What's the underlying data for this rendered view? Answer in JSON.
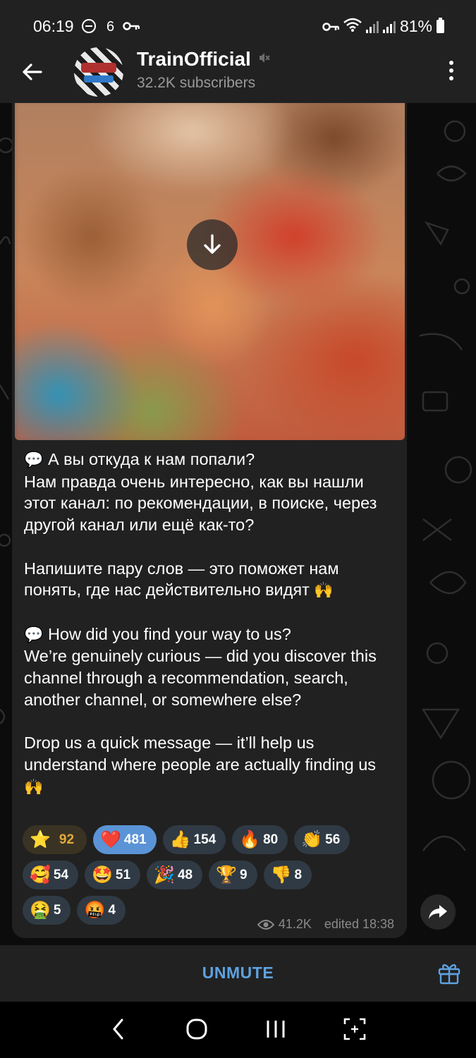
{
  "status_bar": {
    "time": "06:19",
    "notif_count": "6",
    "battery": "81%"
  },
  "header": {
    "channel_name": "TrainOfficial",
    "subscribers": "32.2K subscribers"
  },
  "message": {
    "paragraphs": [
      "А вы откуда к нам попали?\nНам правда очень интересно, как вы нашли этот канал: по рекомендации, в поиске, через другой канал или ещё как-то?",
      "Напишите пару слов — это поможет нам понять, где нас действительно видят",
      "How did you find your way to us?\nWe’re genuinely curious — did you discover this channel through a recommendation, search, another channel, or somewhere else?",
      "Drop us a quick message — it’ll help us understand where people are actually finding us"
    ],
    "p1_line1": "А вы откуда к нам попали?",
    "p1_rest": "Нам правда очень интересно, как вы нашли этот канал: по рекомендации, в поиске, через другой канал или ещё как-то?",
    "p2": "Напишите пару слов — это поможет нам понять, где нас действительно видят",
    "p3_line1": "How did you find your way to us?",
    "p3_rest": "We’re genuinely curious — did you discover this channel through a recommendation, search, another channel, or somewhere else?",
    "p4": "Drop us a quick message — it’ll help us understand where people are actually finding us",
    "views": "41.2K",
    "edited": "edited 18:38"
  },
  "reactions": {
    "row1": [
      {
        "emoji": "⭐",
        "count": "92"
      },
      {
        "emoji": "❤️",
        "count": "481"
      },
      {
        "emoji": "👍",
        "count": "154"
      },
      {
        "emoji": "🔥",
        "count": "80"
      },
      {
        "emoji": "👏",
        "count": "56"
      }
    ],
    "row2": [
      {
        "emoji": "🥰",
        "count": "54"
      },
      {
        "emoji": "🤩",
        "count": "51"
      },
      {
        "emoji": "🎉",
        "count": "48"
      },
      {
        "emoji": "🏆",
        "count": "9"
      },
      {
        "emoji": "👎",
        "count": "8"
      }
    ],
    "row3": [
      {
        "emoji": "🤮",
        "count": "5"
      },
      {
        "emoji": "🤬",
        "count": "4"
      }
    ]
  },
  "bottom_bar": {
    "unmute_label": "UNMUTE"
  },
  "colors": {
    "accent": "#5ea2e0",
    "bubble": "#212121",
    "reaction_pill": "#2f3a44",
    "selected_reaction": "#5b94d6",
    "star_reaction_text": "#e2a93c"
  }
}
